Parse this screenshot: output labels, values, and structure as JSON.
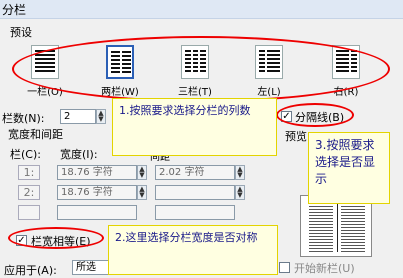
{
  "dialog": {
    "title": "分栏"
  },
  "presets": {
    "label": "预设",
    "items": [
      {
        "label": "一栏(O)"
      },
      {
        "label": "两栏(W)"
      },
      {
        "label": "三栏(T)"
      },
      {
        "label": "左(L)"
      },
      {
        "label": "右(R)"
      }
    ]
  },
  "columns": {
    "count_label": "栏数(N):",
    "count_value": "2",
    "separator_label": "分隔线(B)",
    "preview_label": "预览"
  },
  "width_spacing": {
    "group_label": "宽度和间距",
    "col_header": "栏(C):",
    "width_header": "宽度(I):",
    "spacing_header": "间距",
    "rows": [
      {
        "num": "1:",
        "width": "18.76 字符",
        "spacing": "2.02 字符"
      },
      {
        "num": "2:",
        "width": "18.76 字符"
      }
    ],
    "equal_width_label": "栏宽相等(E)"
  },
  "apply": {
    "label": "应用于(A):",
    "value": "所选",
    "new_column_label": "开始新栏(U)"
  },
  "annotations": {
    "note1": "1.按照要求选择分栏的列数",
    "note2": "2.这里选择分栏宽度是否对称",
    "note3": "3.按照要求选择是否显示"
  }
}
